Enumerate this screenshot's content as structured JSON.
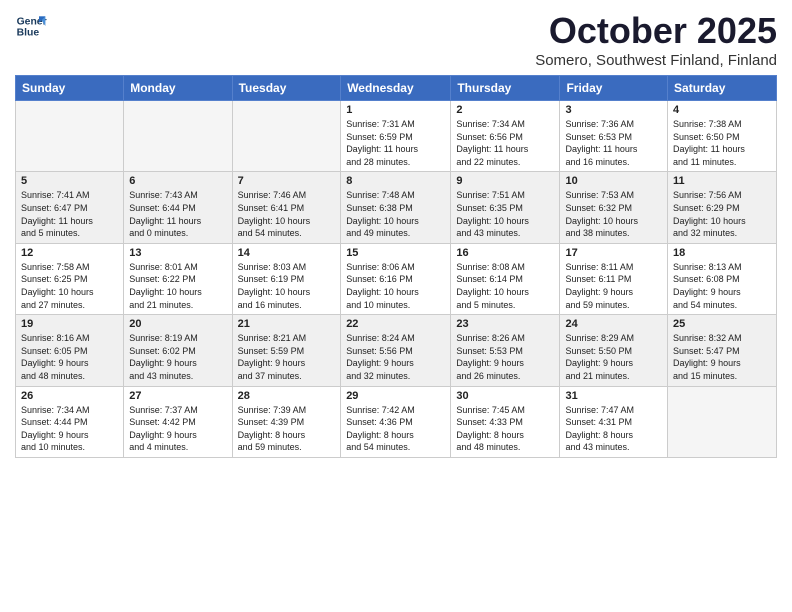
{
  "logo": {
    "line1": "General",
    "line2": "Blue"
  },
  "title": "October 2025",
  "location": "Somero, Southwest Finland, Finland",
  "weekdays": [
    "Sunday",
    "Monday",
    "Tuesday",
    "Wednesday",
    "Thursday",
    "Friday",
    "Saturday"
  ],
  "weeks": [
    [
      {
        "day": "",
        "info": ""
      },
      {
        "day": "",
        "info": ""
      },
      {
        "day": "",
        "info": ""
      },
      {
        "day": "1",
        "info": "Sunrise: 7:31 AM\nSunset: 6:59 PM\nDaylight: 11 hours\nand 28 minutes."
      },
      {
        "day": "2",
        "info": "Sunrise: 7:34 AM\nSunset: 6:56 PM\nDaylight: 11 hours\nand 22 minutes."
      },
      {
        "day": "3",
        "info": "Sunrise: 7:36 AM\nSunset: 6:53 PM\nDaylight: 11 hours\nand 16 minutes."
      },
      {
        "day": "4",
        "info": "Sunrise: 7:38 AM\nSunset: 6:50 PM\nDaylight: 11 hours\nand 11 minutes."
      }
    ],
    [
      {
        "day": "5",
        "info": "Sunrise: 7:41 AM\nSunset: 6:47 PM\nDaylight: 11 hours\nand 5 minutes."
      },
      {
        "day": "6",
        "info": "Sunrise: 7:43 AM\nSunset: 6:44 PM\nDaylight: 11 hours\nand 0 minutes."
      },
      {
        "day": "7",
        "info": "Sunrise: 7:46 AM\nSunset: 6:41 PM\nDaylight: 10 hours\nand 54 minutes."
      },
      {
        "day": "8",
        "info": "Sunrise: 7:48 AM\nSunset: 6:38 PM\nDaylight: 10 hours\nand 49 minutes."
      },
      {
        "day": "9",
        "info": "Sunrise: 7:51 AM\nSunset: 6:35 PM\nDaylight: 10 hours\nand 43 minutes."
      },
      {
        "day": "10",
        "info": "Sunrise: 7:53 AM\nSunset: 6:32 PM\nDaylight: 10 hours\nand 38 minutes."
      },
      {
        "day": "11",
        "info": "Sunrise: 7:56 AM\nSunset: 6:29 PM\nDaylight: 10 hours\nand 32 minutes."
      }
    ],
    [
      {
        "day": "12",
        "info": "Sunrise: 7:58 AM\nSunset: 6:25 PM\nDaylight: 10 hours\nand 27 minutes."
      },
      {
        "day": "13",
        "info": "Sunrise: 8:01 AM\nSunset: 6:22 PM\nDaylight: 10 hours\nand 21 minutes."
      },
      {
        "day": "14",
        "info": "Sunrise: 8:03 AM\nSunset: 6:19 PM\nDaylight: 10 hours\nand 16 minutes."
      },
      {
        "day": "15",
        "info": "Sunrise: 8:06 AM\nSunset: 6:16 PM\nDaylight: 10 hours\nand 10 minutes."
      },
      {
        "day": "16",
        "info": "Sunrise: 8:08 AM\nSunset: 6:14 PM\nDaylight: 10 hours\nand 5 minutes."
      },
      {
        "day": "17",
        "info": "Sunrise: 8:11 AM\nSunset: 6:11 PM\nDaylight: 9 hours\nand 59 minutes."
      },
      {
        "day": "18",
        "info": "Sunrise: 8:13 AM\nSunset: 6:08 PM\nDaylight: 9 hours\nand 54 minutes."
      }
    ],
    [
      {
        "day": "19",
        "info": "Sunrise: 8:16 AM\nSunset: 6:05 PM\nDaylight: 9 hours\nand 48 minutes."
      },
      {
        "day": "20",
        "info": "Sunrise: 8:19 AM\nSunset: 6:02 PM\nDaylight: 9 hours\nand 43 minutes."
      },
      {
        "day": "21",
        "info": "Sunrise: 8:21 AM\nSunset: 5:59 PM\nDaylight: 9 hours\nand 37 minutes."
      },
      {
        "day": "22",
        "info": "Sunrise: 8:24 AM\nSunset: 5:56 PM\nDaylight: 9 hours\nand 32 minutes."
      },
      {
        "day": "23",
        "info": "Sunrise: 8:26 AM\nSunset: 5:53 PM\nDaylight: 9 hours\nand 26 minutes."
      },
      {
        "day": "24",
        "info": "Sunrise: 8:29 AM\nSunset: 5:50 PM\nDaylight: 9 hours\nand 21 minutes."
      },
      {
        "day": "25",
        "info": "Sunrise: 8:32 AM\nSunset: 5:47 PM\nDaylight: 9 hours\nand 15 minutes."
      }
    ],
    [
      {
        "day": "26",
        "info": "Sunrise: 7:34 AM\nSunset: 4:44 PM\nDaylight: 9 hours\nand 10 minutes."
      },
      {
        "day": "27",
        "info": "Sunrise: 7:37 AM\nSunset: 4:42 PM\nDaylight: 9 hours\nand 4 minutes."
      },
      {
        "day": "28",
        "info": "Sunrise: 7:39 AM\nSunset: 4:39 PM\nDaylight: 8 hours\nand 59 minutes."
      },
      {
        "day": "29",
        "info": "Sunrise: 7:42 AM\nSunset: 4:36 PM\nDaylight: 8 hours\nand 54 minutes."
      },
      {
        "day": "30",
        "info": "Sunrise: 7:45 AM\nSunset: 4:33 PM\nDaylight: 8 hours\nand 48 minutes."
      },
      {
        "day": "31",
        "info": "Sunrise: 7:47 AM\nSunset: 4:31 PM\nDaylight: 8 hours\nand 43 minutes."
      },
      {
        "day": "",
        "info": ""
      }
    ]
  ]
}
